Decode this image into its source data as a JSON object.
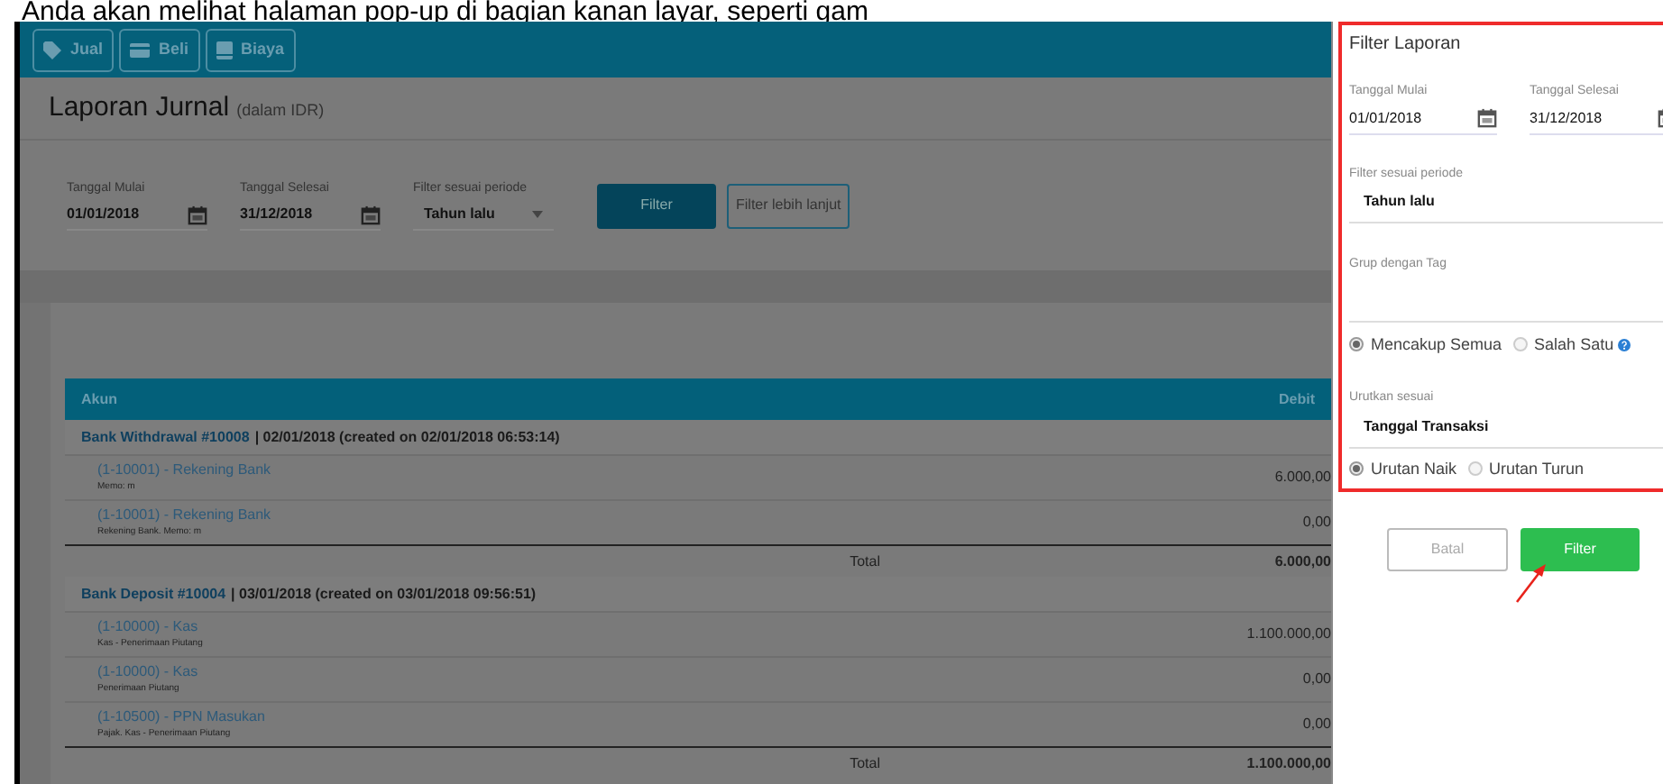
{
  "caption": "Anda akan melihat halaman pop-up di bagian kanan layar, seperti gam",
  "toolbar": {
    "buttons": [
      {
        "label": "Jual",
        "kind": "tag"
      },
      {
        "label": "Beli",
        "kind": "card"
      },
      {
        "label": "Biaya",
        "kind": "doc"
      }
    ]
  },
  "report": {
    "title": "Laporan Jurnal",
    "subtitle": "(dalam IDR)"
  },
  "filters": {
    "start": {
      "label": "Tanggal Mulai",
      "value": "01/01/2018"
    },
    "end": {
      "label": "Tanggal Selesai",
      "value": "31/12/2018"
    },
    "period": {
      "label": "Filter sesuai periode",
      "value": "Tahun lalu"
    },
    "filter_button": "Filter",
    "advanced_button": "Filter lebih lanjut"
  },
  "table": {
    "columns": [
      "Akun",
      "Debit"
    ],
    "groups": [
      {
        "transaction": "Bank Withdrawal #10008",
        "details": "| 02/01/2018 (created on 02/01/2018 06:53:14)",
        "lines": [
          {
            "account": "(1-10001) - Rekening Bank",
            "memo": "Memo: m",
            "debit": "6.000,00"
          },
          {
            "account": "(1-10001) - Rekening Bank",
            "memo": "Rekening Bank. Memo: m",
            "debit": "0,00"
          }
        ],
        "total_label": "Total",
        "total": "6.000,00"
      },
      {
        "transaction": "Bank Deposit #10004",
        "details": "| 03/01/2018 (created on 03/01/2018 09:56:51)",
        "lines": [
          {
            "account": "(1-10000) - Kas",
            "memo": "Kas - Penerimaan Piutang",
            "debit": "1.100.000,00"
          },
          {
            "account": "(1-10000) - Kas",
            "memo": "Penerimaan Piutang",
            "debit": "0,00"
          },
          {
            "account": "(1-10500) - PPN Masukan",
            "memo": "Pajak. Kas - Penerimaan Piutang",
            "debit": "0,00"
          }
        ],
        "total_label": "Total",
        "total": "1.100.000,00"
      }
    ]
  },
  "panel": {
    "title": "Filter Laporan",
    "start": {
      "label": "Tanggal Mulai",
      "value": "01/01/2018"
    },
    "end": {
      "label": "Tanggal Selesai",
      "value": "31/12/2018"
    },
    "period": {
      "label": "Filter sesuai periode",
      "value": "Tahun lalu"
    },
    "tag_label": "Grup dengan Tag",
    "match_options": [
      {
        "label": "Mencakup Semua",
        "selected": true
      },
      {
        "label": "Salah Satu",
        "selected": false,
        "help": true
      }
    ],
    "sort": {
      "label": "Urutkan sesuai",
      "value": "Tanggal Transaksi"
    },
    "order_options": [
      {
        "label": "Urutan Naik",
        "selected": true
      },
      {
        "label": "Urutan Turun",
        "selected": false
      }
    ],
    "cancel_button": "Batal",
    "submit_button": "Filter"
  }
}
